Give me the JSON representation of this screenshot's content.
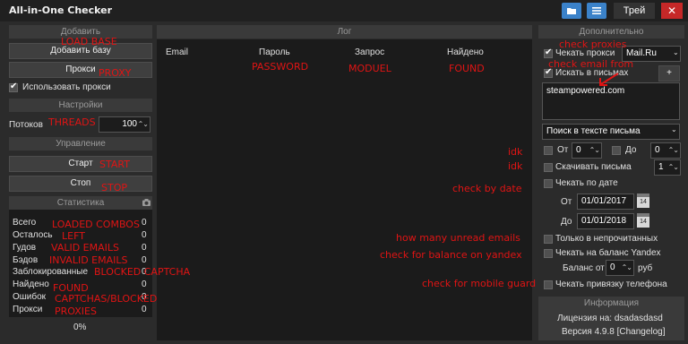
{
  "app": {
    "title": "All-in-One Checker"
  },
  "titlebar": {
    "theme_label": "Трей",
    "close_label": "✕"
  },
  "left": {
    "add_header": "Добавить",
    "add_base_label": "Добавить базу",
    "proxy_label": "Прокси",
    "use_proxy_label": "Использовать прокси",
    "settings_header": "Настройки",
    "threads_label": "Потоков",
    "threads_value": "100",
    "control_header": "Управление",
    "start_label": "Старт",
    "stop_label": "Стоп",
    "stats_header": "Статистика",
    "stats": [
      {
        "label": "Всего",
        "value": "0"
      },
      {
        "label": "Осталось",
        "value": "0"
      },
      {
        "label": "Гудов",
        "value": "0"
      },
      {
        "label": "Бэдов",
        "value": "0"
      },
      {
        "label": "Заблокированные",
        "value": "0"
      },
      {
        "label": "Найдено",
        "value": "0"
      },
      {
        "label": "Ошибок",
        "value": "0"
      },
      {
        "label": "Прокси",
        "value": "0"
      }
    ],
    "progress": "0%"
  },
  "log": {
    "header": "Лог",
    "columns": [
      "Email",
      "Пароль",
      "Запрос",
      "Найдено"
    ]
  },
  "right": {
    "header": "Дополнительно",
    "check_proxy_label": "Чекать прокси",
    "proxy_service": "Mail.Ru",
    "search_letters_label": "Искать в письмах",
    "plus_label": "+",
    "search_text": "steampowered.com",
    "search_mode": "Поиск в тексте письма",
    "from_label": "От",
    "from_value": "0",
    "to_label": "До",
    "to_value": "0",
    "download_label": "Скачивать письма",
    "download_value": "1",
    "check_date_label": "Чекать по дате",
    "date_from_label": "От",
    "date_from": "01/01/2017",
    "date_to_label": "До",
    "date_to": "01/01/2018",
    "calendar_day": "14",
    "unread_label": "Только в непрочитанных",
    "yandex_label": "Чекать на баланс Yandex",
    "balance_label": "Баланс от",
    "balance_value": "0",
    "balance_unit": "руб",
    "phone_label": "Чекать привязку телефона",
    "info_header": "Информация",
    "license": "Лицензия на: dsadasdasd",
    "version": "Версия 4.9.8 [Changelog]"
  },
  "annotations": {
    "load_base": "LOAD BASE",
    "proxy": "PROXY",
    "threads": "THREADS",
    "start": "START",
    "stop": "STOP",
    "loaded": "LOADED COMBOS",
    "left": "LEFT",
    "valid": "VALID EMAILS",
    "invalid": "INVALID EMAILS",
    "blocked": "BLOCKED CAPTCHA",
    "found": "FOUND",
    "captchas": "CAPTCHAS/BLOCKED",
    "proxies": "PROXIES",
    "password": "PASSWORD",
    "moduel": "MODUEL",
    "found_col": "FOUND",
    "check_proxies": "check proxies",
    "check_email": "check email from",
    "idk1": "idk",
    "idk2": "idk",
    "check_date": "check by date",
    "unread": "how many unread emails",
    "yandex": "check for balance on yandex",
    "mobile": "check for mobile guard"
  },
  "colors": {
    "accent": "#3b82c9",
    "annotation": "#e01414",
    "close": "#c62828"
  }
}
